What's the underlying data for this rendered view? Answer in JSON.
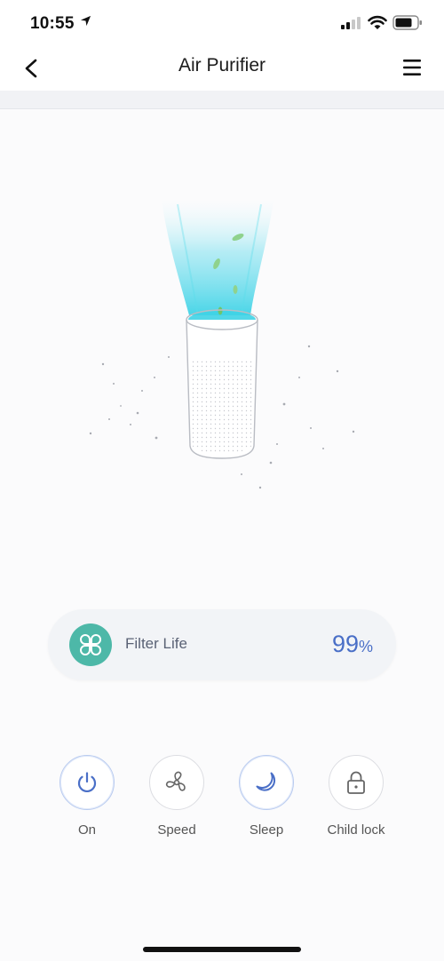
{
  "status_bar": {
    "time": "10:55"
  },
  "header": {
    "title": "Air Purifier"
  },
  "filter": {
    "label": "Filter Life",
    "value": "99",
    "unit": "%"
  },
  "controls": [
    {
      "label": "On",
      "icon": "power-icon",
      "active": true
    },
    {
      "label": "Speed",
      "icon": "fan-icon",
      "active": false
    },
    {
      "label": "Sleep",
      "icon": "moon-icon",
      "active": true
    },
    {
      "label": "Child lock",
      "icon": "lock-icon",
      "active": false
    }
  ],
  "colors": {
    "accent": "#4a6fc7",
    "filter_icon_bg": "#4db8a8",
    "airflow": "#3fd3e6"
  }
}
